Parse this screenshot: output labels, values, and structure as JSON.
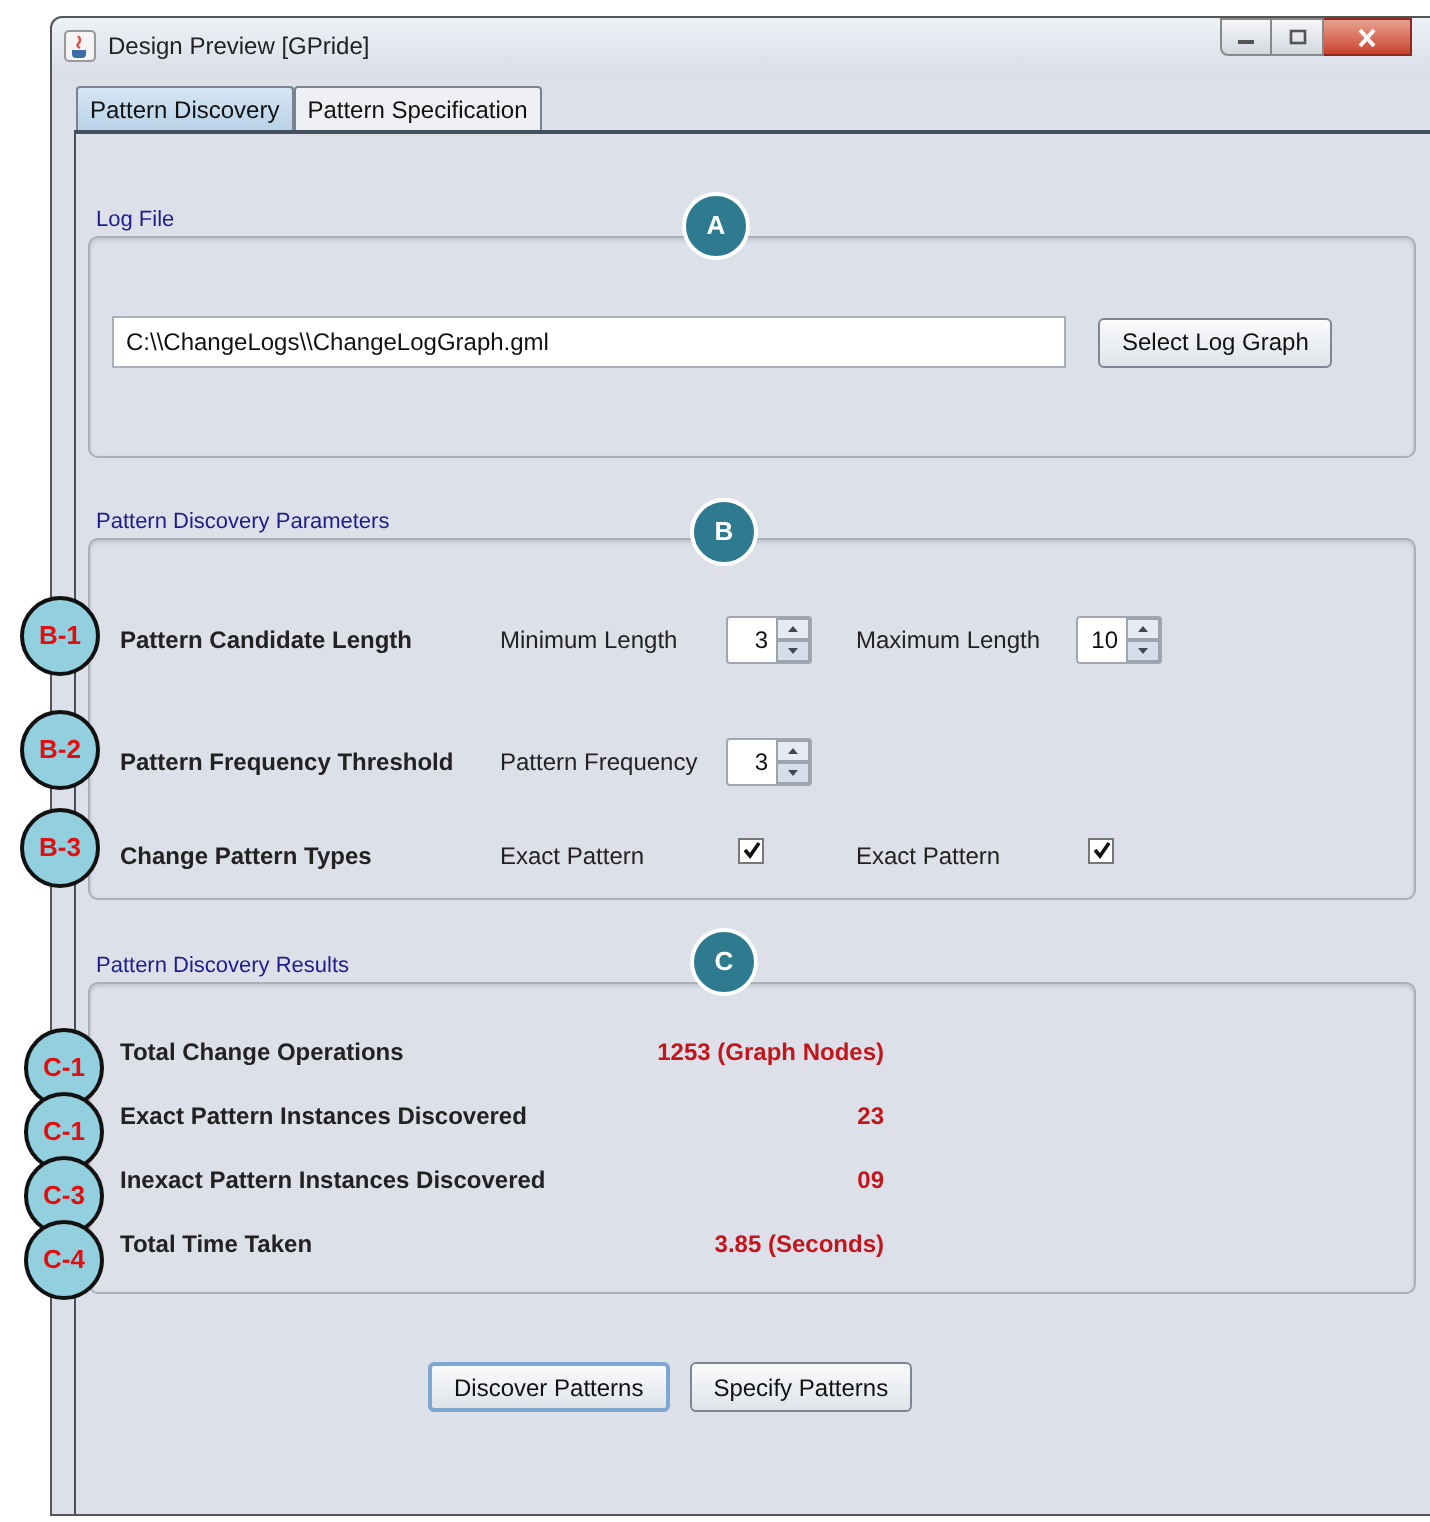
{
  "window": {
    "title": "Design Preview [GPride]"
  },
  "tabs": [
    {
      "label": "Pattern Discovery",
      "selected": true
    },
    {
      "label": "Pattern Specification",
      "selected": false
    }
  ],
  "log_file": {
    "title": "Log File",
    "callout": "A",
    "path": "C:\\\\ChangeLogs\\\\ChangeLogGraph.gml",
    "button": "Select Log Graph"
  },
  "parameters": {
    "title": "Pattern Discovery Parameters",
    "callout": "B",
    "rows": [
      {
        "callout": "B-1",
        "label": "Pattern Candidate Length",
        "kind": "spinners",
        "fields": [
          {
            "label": "Minimum Length",
            "value": "3"
          },
          {
            "label": "Maximum Length",
            "value": "10"
          }
        ]
      },
      {
        "callout": "B-2",
        "label": "Pattern Frequency Threshold",
        "kind": "spinners",
        "fields": [
          {
            "label": "Pattern Frequency",
            "value": "3"
          }
        ]
      },
      {
        "callout": "B-3",
        "label": "Change Pattern Types",
        "kind": "checkboxes",
        "fields": [
          {
            "label": "Exact Pattern",
            "checked": true
          },
          {
            "label": "Exact Pattern",
            "checked": true
          }
        ]
      }
    ]
  },
  "results": {
    "title": "Pattern Discovery Results",
    "callout": "C",
    "rows": [
      {
        "callout": "C-1",
        "label": "Total Change Operations",
        "value": "1253 (Graph Nodes)"
      },
      {
        "callout": "C-1",
        "label": "Exact Pattern Instances Discovered",
        "value": "23"
      },
      {
        "callout": "C-3",
        "label": "Inexact Pattern Instances Discovered",
        "value": "09"
      },
      {
        "callout": "C-4",
        "label": "Total Time Taken",
        "value": "3.85 (Seconds)"
      }
    ]
  },
  "buttons": [
    {
      "label": "Discover Patterns",
      "selected": true
    },
    {
      "label": "Specify Patterns",
      "selected": false
    }
  ]
}
